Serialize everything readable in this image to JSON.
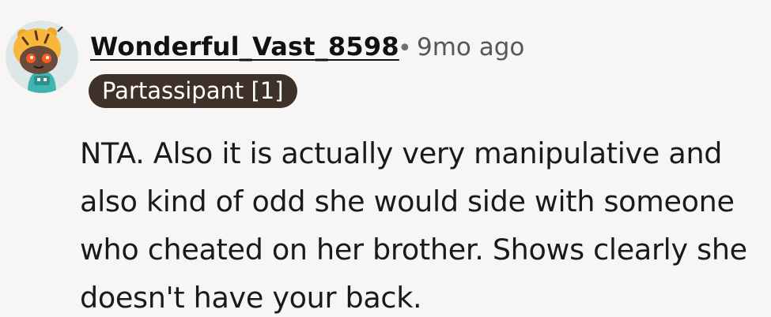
{
  "comment": {
    "author": {
      "username": "Wonderful_Vast_8598",
      "avatar_icon": "snoo-tiger-hat-avatar-icon"
    },
    "separator": "•",
    "timestamp": "9mo ago",
    "flair": "Partassipant [1]",
    "body_lines": [
      "NTA. Also it is actually very manipulative and",
      "also kind of odd she would side with someone",
      "who cheated on her brother. Shows clearly she",
      "doesn't have your back."
    ]
  },
  "colors": {
    "background": "#f8f6f4",
    "flair_background": "#3e3129",
    "flair_text": "#ffffff",
    "meta_text": "#575757"
  }
}
